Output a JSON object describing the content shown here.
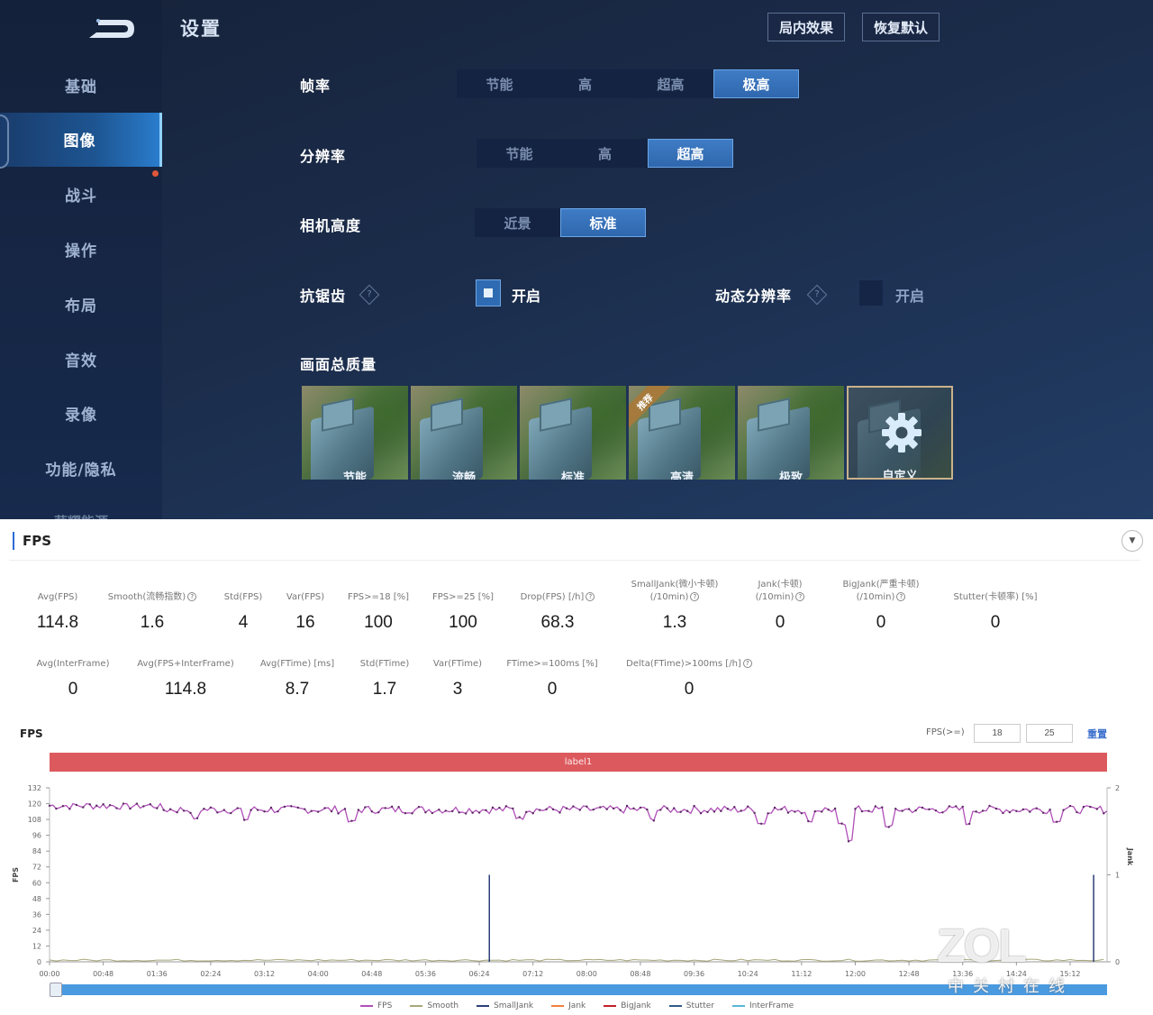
{
  "game": {
    "title": "设置",
    "top_buttons": [
      "局内效果",
      "恢复默认"
    ],
    "sidebar": [
      {
        "label": "基础",
        "active": false
      },
      {
        "label": "图像",
        "active": true
      },
      {
        "label": "战斗",
        "active": false
      },
      {
        "label": "操作",
        "active": false
      },
      {
        "label": "布局",
        "active": false
      },
      {
        "label": "音效",
        "active": false
      },
      {
        "label": "录像",
        "active": false
      },
      {
        "label": "功能/隐私",
        "active": false
      }
    ],
    "sidebar_cut_label": "荣耀能源",
    "frame_rate": {
      "label": "帧率",
      "options": [
        "节能",
        "高",
        "超高",
        "极高"
      ],
      "selected": "极高"
    },
    "resolution": {
      "label": "分辨率",
      "options": [
        "节能",
        "高",
        "超高"
      ],
      "selected": "超高"
    },
    "camera_height": {
      "label": "相机高度",
      "options": [
        "近景",
        "标准"
      ],
      "selected": "标准"
    },
    "anti_aliasing": {
      "label": "抗锯齿",
      "toggle_label": "开启",
      "checked": true,
      "help": "?"
    },
    "dynamic_resolution": {
      "label": "动态分辨率",
      "toggle_label": "开启",
      "checked": false,
      "help": "?"
    },
    "overall_quality": {
      "label": "画面总质量",
      "presets": [
        {
          "label": "节能",
          "badge": null,
          "selected": false
        },
        {
          "label": "流畅",
          "badge": null,
          "selected": false
        },
        {
          "label": "标准",
          "badge": null,
          "selected": false
        },
        {
          "label": "高清",
          "badge": "推荐",
          "selected": false
        },
        {
          "label": "极致",
          "badge": null,
          "selected": false
        },
        {
          "label": "自定义",
          "badge": null,
          "selected": true
        }
      ]
    }
  },
  "report": {
    "section_title": "FPS",
    "stats_row1": [
      {
        "label": "Avg(FPS)",
        "value": "114.8",
        "help": false
      },
      {
        "label": "Smooth(流畅指数)",
        "value": "1.6",
        "help": true
      },
      {
        "label": "Std(FPS)",
        "value": "4",
        "help": false
      },
      {
        "label": "Var(FPS)",
        "value": "16",
        "help": false
      },
      {
        "label": "FPS>=18 [%]",
        "value": "100",
        "help": false
      },
      {
        "label": "FPS>=25 [%]",
        "value": "100",
        "help": false
      },
      {
        "label": "Drop(FPS) [/h]",
        "value": "68.3",
        "help": true
      },
      {
        "label": "SmallJank(微小卡顿)\n(/10min)",
        "value": "1.3",
        "help": true
      },
      {
        "label": "Jank(卡顿)\n(/10min)",
        "value": "0",
        "help": true
      },
      {
        "label": "BigJank(严重卡顿)\n(/10min)",
        "value": "0",
        "help": true
      },
      {
        "label": "Stutter(卡顿率) [%]",
        "value": "0",
        "help": false
      }
    ],
    "stats_row2": [
      {
        "label": "Avg(InterFrame)",
        "value": "0",
        "help": false
      },
      {
        "label": "Avg(FPS+InterFrame)",
        "value": "114.8",
        "help": false
      },
      {
        "label": "Avg(FTime) [ms]",
        "value": "8.7",
        "help": false
      },
      {
        "label": "Std(FTime)",
        "value": "1.7",
        "help": false
      },
      {
        "label": "Var(FTime)",
        "value": "3",
        "help": false
      },
      {
        "label": "FTime>=100ms [%]",
        "value": "0",
        "help": false
      },
      {
        "label": "Delta(FTime)>100ms [/h]",
        "value": "0",
        "help": true
      }
    ],
    "chart_header": "FPS",
    "fps_filter_label": "FPS(>=)",
    "fps_filter_values": [
      "18",
      "25"
    ],
    "reset_label": "重置",
    "label_bar": "label1"
  },
  "chart_data": {
    "type": "line",
    "title": "FPS",
    "xlabel": "",
    "ylabel": "FPS",
    "y2label": "Jank",
    "x_ticks": [
      "00:00",
      "00:48",
      "01:36",
      "02:24",
      "03:12",
      "04:00",
      "04:48",
      "05:36",
      "06:24",
      "07:12",
      "08:00",
      "08:48",
      "09:36",
      "10:24",
      "11:12",
      "12:00",
      "12:48",
      "13:36",
      "14:24",
      "15:12"
    ],
    "y_ticks": [
      0,
      12,
      24,
      36,
      48,
      60,
      72,
      84,
      96,
      108,
      120,
      132
    ],
    "y2_ticks": [
      0,
      1,
      2
    ],
    "ylim": [
      0,
      132
    ],
    "y2lim": [
      0,
      2
    ],
    "duration_seconds": 945,
    "legend": [
      "FPS",
      "Smooth",
      "SmallJank",
      "Jank",
      "BigJank",
      "Stutter",
      "InterFrame"
    ],
    "legend_placement": "bottom",
    "series": [
      {
        "name": "FPS",
        "color": "#b04fb8",
        "axis": "left",
        "summary": {
          "mean": 114.8,
          "min": 91,
          "max": 120
        },
        "dips": [
          {
            "t": 130,
            "v": 108
          },
          {
            "t": 176,
            "v": 107
          },
          {
            "t": 270,
            "v": 106
          },
          {
            "t": 420,
            "v": 108
          },
          {
            "t": 538,
            "v": 107
          },
          {
            "t": 636,
            "v": 104
          },
          {
            "t": 680,
            "v": 105
          },
          {
            "t": 708,
            "v": 103
          },
          {
            "t": 715,
            "v": 91
          },
          {
            "t": 750,
            "v": 102
          },
          {
            "t": 820,
            "v": 104
          },
          {
            "t": 900,
            "v": 106
          }
        ]
      },
      {
        "name": "Smooth",
        "color": "#a7a77a",
        "axis": "left",
        "summary": {
          "mean": 1.6
        }
      },
      {
        "name": "SmallJank",
        "color": "#2b3f7a",
        "axis": "right",
        "events": [
          {
            "t": 393,
            "v": 1
          },
          {
            "t": 933,
            "v": 1
          }
        ]
      },
      {
        "name": "Jank",
        "color": "#f08040",
        "axis": "right",
        "events": []
      },
      {
        "name": "BigJank",
        "color": "#c0202a",
        "axis": "right",
        "events": []
      },
      {
        "name": "Stutter",
        "color": "#305a8a",
        "axis": "right",
        "events": []
      },
      {
        "name": "InterFrame",
        "color": "#5ab5d6",
        "axis": "left",
        "events": []
      }
    ]
  },
  "watermark": {
    "logo": "ZOL",
    "text": "中关村在线"
  }
}
